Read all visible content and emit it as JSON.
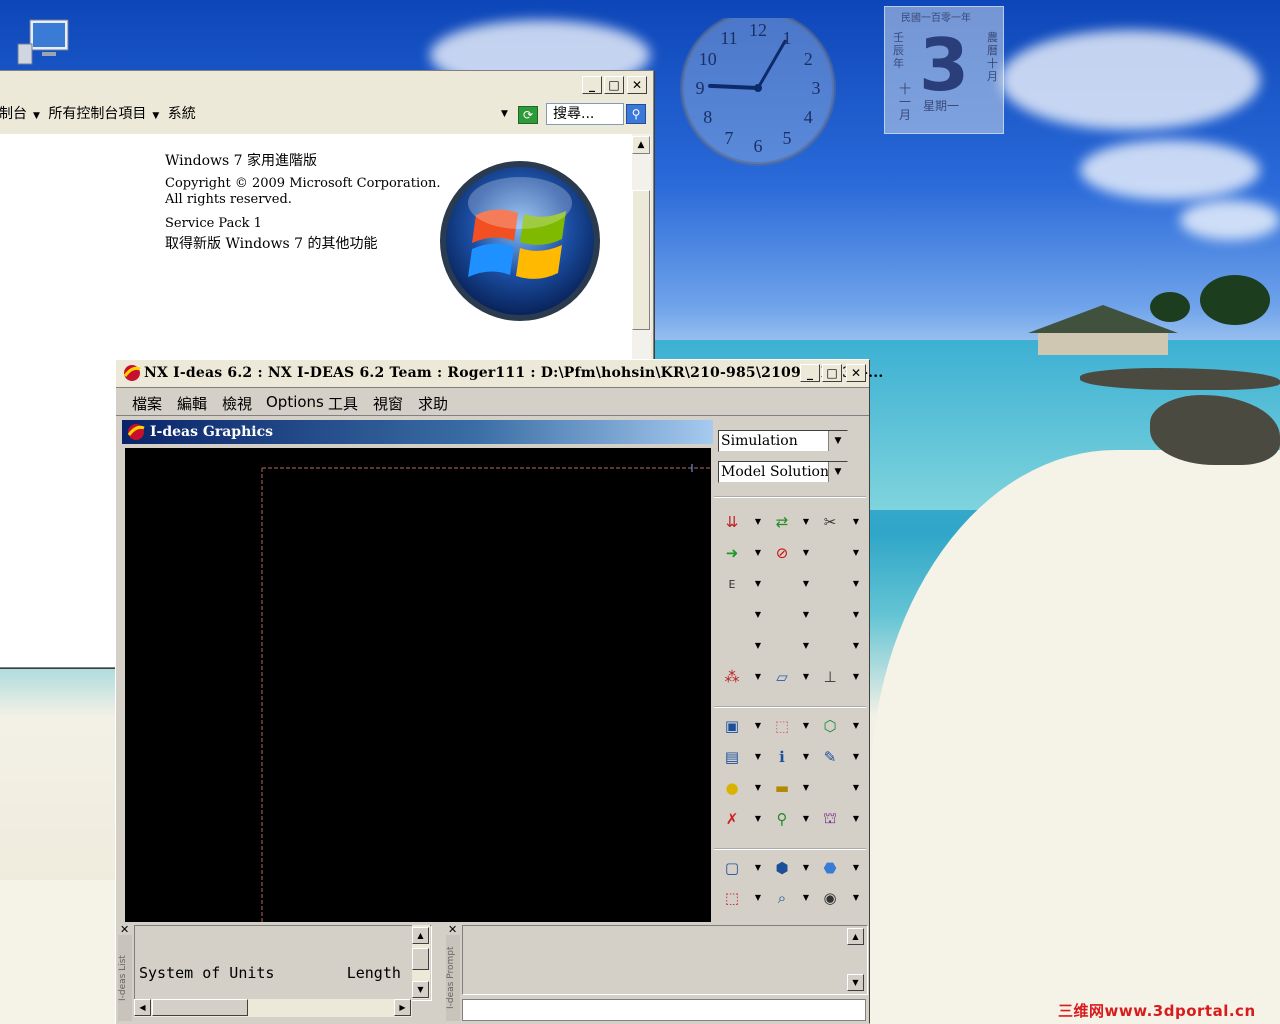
{
  "desktop": {
    "icon_name": "computer-icon",
    "watermark": "三维网www.3dportal.cn"
  },
  "calendar_gadget": {
    "header": "民國一百零一年",
    "day": "3",
    "left_text": "壬辰年",
    "right_text": "農曆十月",
    "month": "十一月",
    "weekday": "星期一"
  },
  "clock_gadget": {
    "time_hour": 9,
    "time_minute": 5,
    "numerals": [
      "12",
      "1",
      "2",
      "3",
      "4",
      "5",
      "6",
      "7",
      "8",
      "9",
      "10",
      "11"
    ]
  },
  "control_panel": {
    "breadcrumb": [
      "制台",
      "所有控制台項目",
      "系統"
    ],
    "search_placeholder": "搜尋...",
    "edition": "Windows 7 家用進階版",
    "copyright_line1": "Copyright © 2009 Microsoft Corporation.",
    "copyright_line2": "All rights reserved.",
    "service_pack": "Service Pack 1",
    "more_features": "取得新版 Windows 7 的其他功能",
    "section_label": "系統",
    "window_buttons": {
      "minimize": "_",
      "maximize": "□",
      "close": "✕"
    }
  },
  "ideas": {
    "title": "NX I-deas 6.2 :     NX I-DEAS 6.2 Team : Roger111 : D:\\Pfm\\hohsin\\KR\\210-985\\210985ET30-...",
    "menu": [
      "檔案",
      "編輯",
      "檢視",
      "Options",
      "工具",
      "視窗",
      "求助"
    ],
    "graphics_title": "I-deas Graphics",
    "application_dropdown": "Simulation",
    "task_dropdown": "Model Solution",
    "list_text": "System of Units        Length",
    "list_label": "I-deas List",
    "prompt_label": "I-deas Prompt",
    "window_buttons": {
      "minimize": "_",
      "maximize": "□",
      "close": "✕"
    }
  },
  "colors": {
    "graphics_title_start": "#0a246a",
    "graphics_canvas": "#000000",
    "panel_gray": "#d4d0c8"
  }
}
